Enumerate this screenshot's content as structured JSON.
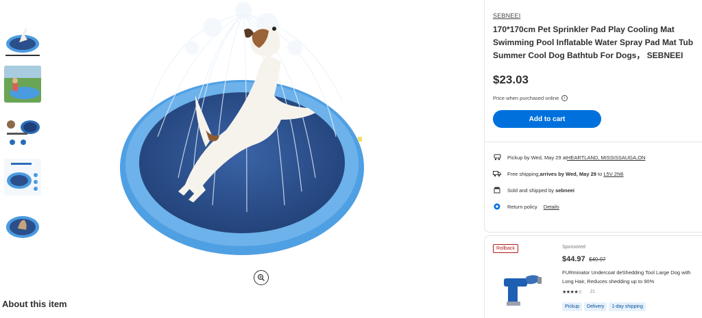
{
  "thumbnails": [
    {
      "name": "thumb-dog-jumping",
      "active": true
    },
    {
      "name": "thumb-kids-playing"
    },
    {
      "name": "thumb-pool-diagram"
    },
    {
      "name": "thumb-pool-accessories"
    },
    {
      "name": "thumb-dog-sitting"
    }
  ],
  "about_heading": "About this item",
  "product": {
    "brand": "SEBNEEI",
    "title": "170*170cm Pet Sprinkler Pad Play Cooling Mat Swimming Pool Inflatable Water Spray Pad Mat Tub Summer Cool Dog Bathtub For Dogs， SEBNEEI",
    "price": "$23.03",
    "price_note": "Price when purchased online",
    "add_to_cart": "Add to cart"
  },
  "fulfillment": {
    "pickup_prefix": "Pickup by Wed, May 29 at ",
    "pickup_location": "HEARTLAND, MISSISSAUGA,ON",
    "shipping_prefix": "Free shipping, ",
    "shipping_bold": "arrives by Wed, May 29",
    "shipping_mid": " to ",
    "shipping_postal": "L5V 2N6",
    "sold_prefix": "Sold and shipped by ",
    "sold_by": "sebneei",
    "return_label": "Return policy",
    "return_link": "Details"
  },
  "sponsored_card": {
    "badge": "Rollback",
    "sponsored_label": "Sponsored",
    "price": "$44.97",
    "was_price": "$49.97",
    "title": "FURminator Undercoat deShedding Tool Large Dog with Long Hair, Reduces shedding up to 90%",
    "stars": "★★★★☆",
    "rating_count": "21",
    "tags": [
      "Pickup",
      "Delivery",
      "1-day shipping"
    ]
  },
  "colors": {
    "primary_blue": "#0071dc",
    "rollback_red": "#b5181b",
    "pool_blue": "#4a9be0",
    "pool_inner": "#2b4f8a"
  }
}
